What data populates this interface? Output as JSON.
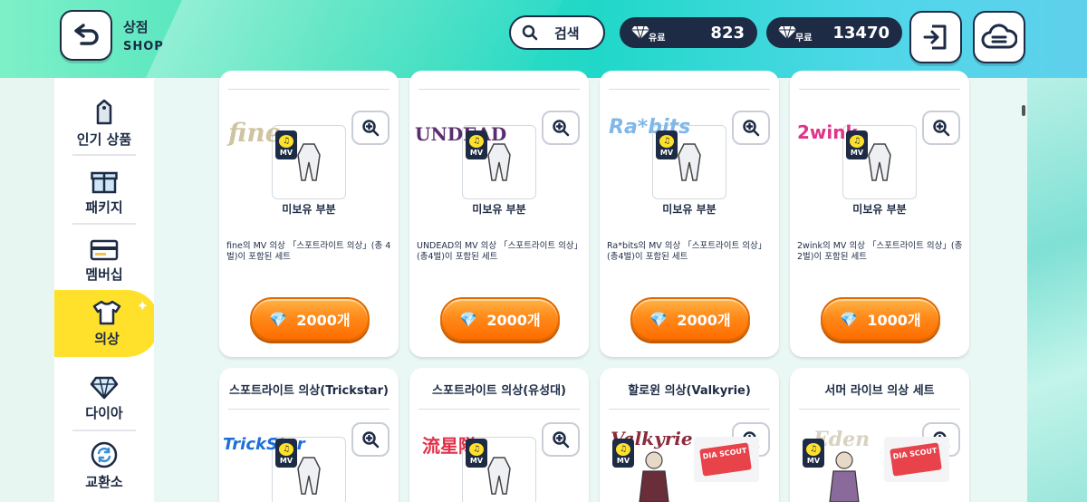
{
  "header": {
    "title": "상점",
    "subtitle": "SHOP",
    "search_label": "검색",
    "paid": {
      "tag": "유료",
      "value": "823"
    },
    "free": {
      "tag": "무료",
      "value": "13470"
    }
  },
  "sidebar": {
    "items": [
      {
        "label": "인기 상품",
        "icon": "price-tag-icon"
      },
      {
        "label": "패키지",
        "icon": "gift-box-icon"
      },
      {
        "label": "멤버십",
        "icon": "membership-card-icon"
      },
      {
        "label": "의상",
        "icon": "shirt-icon",
        "active": true
      },
      {
        "label": "다이아",
        "icon": "diamond-icon"
      },
      {
        "label": "교환소",
        "icon": "exchange-icon"
      }
    ]
  },
  "cards_row1": [
    {
      "logo": "fine",
      "mv": "MV",
      "status": "미보유 부분",
      "desc": "fine의 MV 의상 「스포트라이트 의상」(총 4벌)이 포함된 세트",
      "price": "2000개"
    },
    {
      "logo": "UNDEAD",
      "mv": "MV",
      "status": "미보유 부분",
      "desc": "UNDEAD의 MV 의상 「스포트라이트 의상」(총4벌)이 포함된 세트",
      "price": "2000개"
    },
    {
      "logo": "Ra*bits",
      "mv": "MV",
      "status": "미보유 부분",
      "desc": "Ra*bits의 MV 의상 「스포트라이트 의상」(총4벌)이 포함된 세트",
      "price": "2000개"
    },
    {
      "logo": "2wink",
      "mv": "MV",
      "status": "미보유 부분",
      "desc": "2wink의 MV 의상 「스포트라이트 의상」(총2벌)이 포함된 세트",
      "price": "1000개"
    }
  ],
  "cards_row2": [
    {
      "title": "스포트라이트 의상(Trickstar)",
      "logo": "TrickStar",
      "mv": "MV"
    },
    {
      "title": "스포트라이트 의상(유성대)",
      "logo": "流星隊",
      "mv": "MV"
    },
    {
      "title": "할로윈 의상(Valkyrie)",
      "logo": "Valkyrie",
      "mv": "MV",
      "ticket": "DIA SCOUT"
    },
    {
      "title": "서머 라이브 의상 세트",
      "logo": "Eden",
      "mv": "MV",
      "ticket": "DIA SCOUT"
    }
  ],
  "colors": {
    "navy": "#1d2b45",
    "accent_yellow": "#ffe12b",
    "buy_orange": "#ff8a1a",
    "header_teal": "#20d8c8"
  }
}
